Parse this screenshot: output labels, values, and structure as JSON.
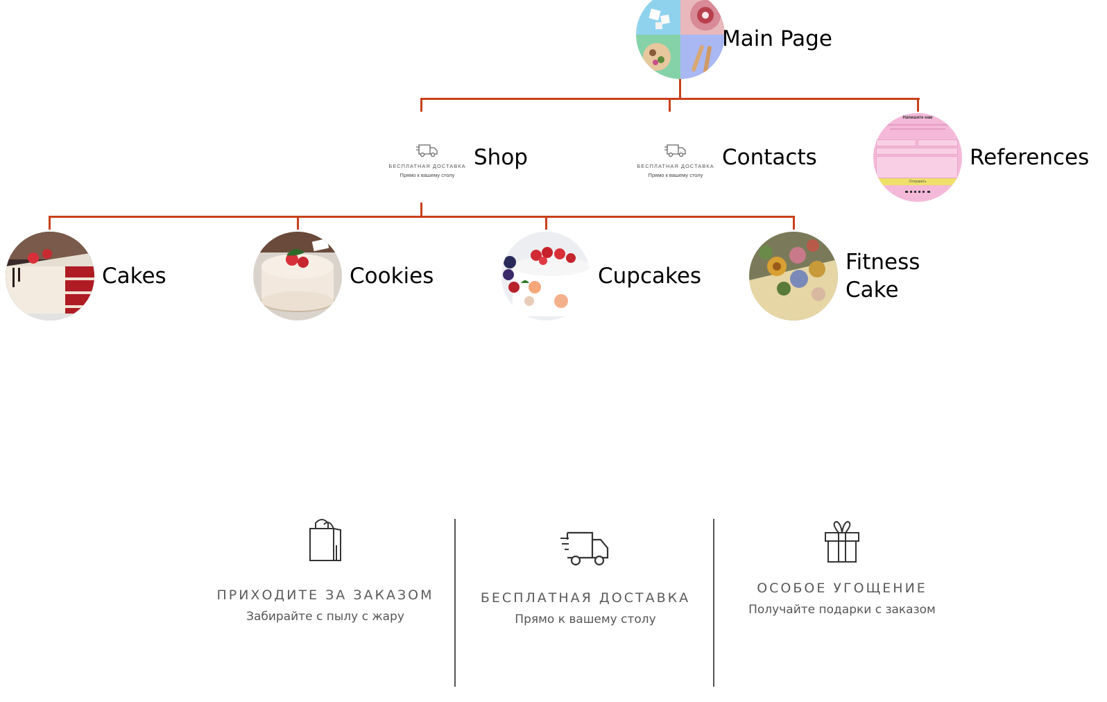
{
  "nodes": {
    "main": "Main Page",
    "shop": "Shop",
    "contacts": "Contacts",
    "references": "References",
    "cakes": "Cakes",
    "cookies": "Cookies",
    "cupcakes": "Cupcakes",
    "fitness_line1": "Fitness",
    "fitness_line2": "Cake"
  },
  "mini_delivery": {
    "title": "БЕСПЛАТНАЯ ДОСТАВКА",
    "subtitle": "Прямо к вашему столу"
  },
  "references_form": {
    "heading": "Напишите нам",
    "button": "Отправить"
  },
  "features": [
    {
      "title": "ПРИХОДИТЕ ЗА ЗАКАЗОМ",
      "subtitle": "Забирайте с пылу с жару",
      "icon": "shopping-bag-icon"
    },
    {
      "title": "БЕСПЛАТНАЯ ДОСТАВКА",
      "subtitle": "Прямо к вашему столу",
      "icon": "delivery-truck-icon"
    },
    {
      "title": "ОСОБОЕ УГОЩЕНИЕ",
      "subtitle": "Получайте подарки с заказом",
      "icon": "gift-icon"
    }
  ],
  "colors": {
    "connector": "#c8401a"
  }
}
